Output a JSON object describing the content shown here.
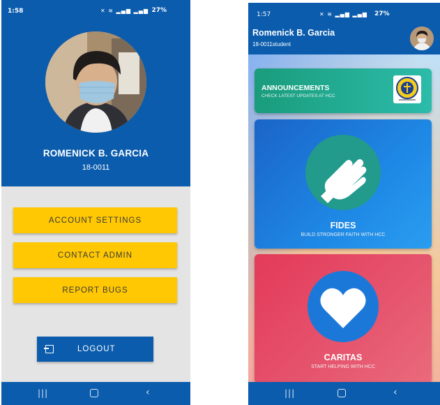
{
  "left_screen": {
    "status": {
      "time": "1:58",
      "battery": "27%"
    },
    "profile": {
      "name": "ROMENICK B. GARCIA",
      "id": "18-0011"
    },
    "menu": {
      "account_settings": "ACCOUNT SETTINGS",
      "contact_admin": "CONTACT ADMIN",
      "report_bugs": "REPORT BUGS",
      "logout": "LOGOUT"
    }
  },
  "right_screen": {
    "status": {
      "time": "1:57",
      "battery": "27%"
    },
    "header": {
      "name": "Romenick B. Garcia",
      "subtitle": "18-0011student"
    },
    "cards": {
      "announcements": {
        "title": "ANNOUNCEMENTS",
        "subtitle": "CHECK LATEST UPDATES AT HCC"
      },
      "fides": {
        "title": "FIDES",
        "subtitle": "BUILD STRONGER FAITH WITH HCC"
      },
      "caritas": {
        "title": "CARITAS",
        "subtitle": "START HELPING WITH HCC"
      }
    }
  },
  "colors": {
    "primary_blue": "#0b5cad",
    "button_yellow": "#ffc803",
    "announcements_teal": "#1a9c7c",
    "fides_blue": "#1e88e5",
    "caritas_red": "#e43a5a"
  },
  "icons": [
    "praying-hands-icon",
    "heart-icon",
    "logout-icon",
    "recent-apps-icon",
    "home-icon",
    "back-icon"
  ]
}
